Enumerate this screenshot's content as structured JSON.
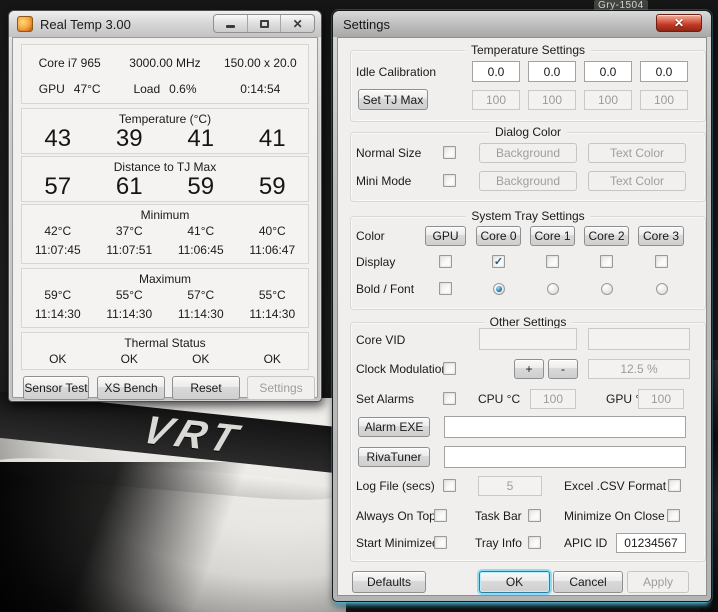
{
  "background": {
    "watermark": "Gry-1504",
    "car_label": "VRT"
  },
  "glyphs": {
    "close": "✕",
    "check": "✓"
  },
  "realtemp": {
    "title": "Real Temp 3.00",
    "info": {
      "cpu_name": "Core i7 965",
      "frequency": "3000.00 MHz",
      "bus_multiplier": "150.00 x 20.0",
      "gpu_label": "GPU",
      "gpu_temp": "47°C",
      "load_label": "Load",
      "load_value": "0.6%",
      "timer": "0:14:54"
    },
    "temperature": {
      "header": "Temperature (°C)",
      "values": [
        "43",
        "39",
        "41",
        "41"
      ]
    },
    "distance": {
      "header": "Distance to TJ Max",
      "values": [
        "57",
        "61",
        "59",
        "59"
      ]
    },
    "minimum": {
      "header": "Minimum",
      "temps": [
        "42°C",
        "37°C",
        "41°C",
        "40°C"
      ],
      "times": [
        "11:07:45",
        "11:07:51",
        "11:06:45",
        "11:06:47"
      ]
    },
    "maximum": {
      "header": "Maximum",
      "temps": [
        "59°C",
        "55°C",
        "57°C",
        "55°C"
      ],
      "times": [
        "11:14:30",
        "11:14:30",
        "11:14:30",
        "11:14:30"
      ]
    },
    "thermal": {
      "header": "Thermal Status",
      "values": [
        "OK",
        "OK",
        "OK",
        "OK"
      ]
    },
    "buttons": {
      "sensor_test": "Sensor Test",
      "xs_bench": "XS Bench",
      "reset": "Reset",
      "settings": "Settings"
    }
  },
  "settings": {
    "title": "Settings",
    "temperature_settings": {
      "header": "Temperature Settings",
      "idle_label": "Idle Calibration",
      "idle_values": [
        "0.0",
        "0.0",
        "0.0",
        "0.0"
      ],
      "tj_button": "Set TJ Max",
      "tj_values": [
        "100",
        "100",
        "100",
        "100"
      ]
    },
    "dialog_color": {
      "header": "Dialog Color",
      "normal_label": "Normal Size",
      "mini_label": "Mini Mode",
      "background_label": "Background",
      "text_color_label": "Text Color"
    },
    "system_tray": {
      "header": "System Tray Settings",
      "color_label": "Color",
      "core_buttons": [
        "GPU",
        "Core 0",
        "Core 1",
        "Core 2",
        "Core 3"
      ],
      "display_label": "Display",
      "display_checked": [
        false,
        true,
        false,
        false,
        false
      ],
      "bold_font_label": "Bold / Font",
      "bold_font_selected": "Core 0"
    },
    "other": {
      "header": "Other Settings",
      "core_vid_label": "Core VID",
      "clock_label": "Clock Modulation",
      "plus": "+",
      "minus": "-",
      "clock_value": "12.5 %",
      "alarms_label": "Set Alarms",
      "cpu_label": "CPU °C",
      "cpu_value": "100",
      "gpu_label": "GPU °C",
      "gpu_value": "100",
      "alarm_exe_label": "Alarm EXE",
      "rivatuner_label": "RivaTuner",
      "log_label": "Log File (secs)",
      "log_value": "5",
      "excel_label": "Excel .CSV Format",
      "top_label": "Always On Top",
      "taskbar_label": "Task Bar",
      "min_close_label": "Minimize On Close",
      "start_min_label": "Start Minimized",
      "tray_info_label": "Tray Info",
      "apic_label": "APIC ID",
      "apic_value": "01234567"
    },
    "footer": {
      "defaults": "Defaults",
      "ok": "OK",
      "cancel": "Cancel",
      "apply": "Apply"
    }
  },
  "colors": {
    "close_button": "#c23a24",
    "default_focus": "#8edcf2",
    "check": "#30597f"
  }
}
